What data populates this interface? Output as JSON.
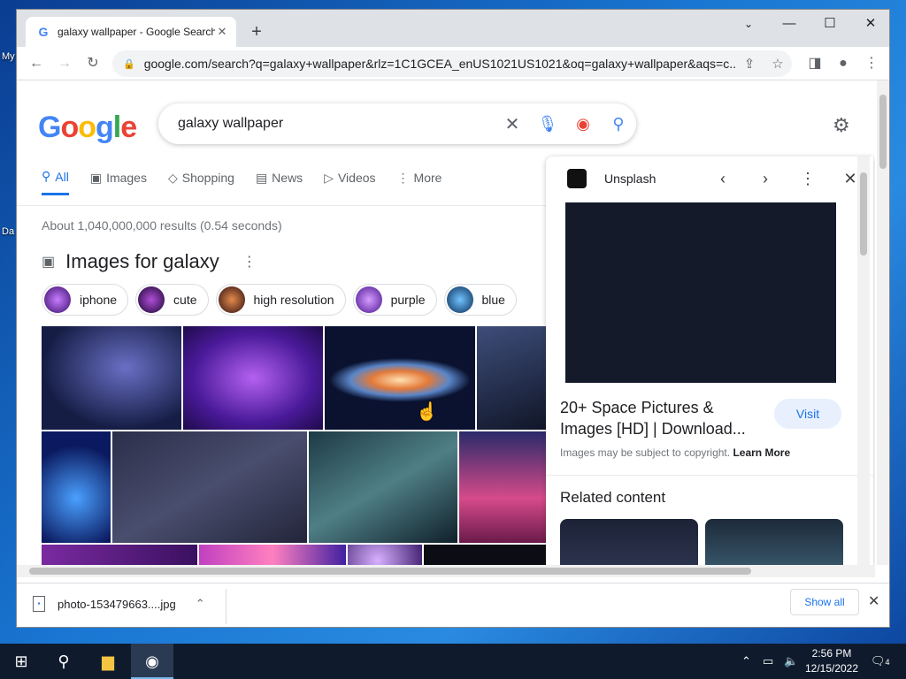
{
  "browser": {
    "tab_title": "galaxy wallpaper - Google Search",
    "new_tab_label": "+",
    "url": "google.com/search?q=galaxy+wallpaper&rlz=1C1GCEA_enUS1021US1021&oq=galaxy+wallpaper&aqs=c..."
  },
  "search": {
    "query": "galaxy wallpaper",
    "logo_text": "Google"
  },
  "nav_tabs": [
    {
      "label": "All"
    },
    {
      "label": "Images"
    },
    {
      "label": "Shopping"
    },
    {
      "label": "News"
    },
    {
      "label": "Videos"
    },
    {
      "label": "More"
    }
  ],
  "results_stats": "About 1,040,000,000 results (0.54 seconds)",
  "images_section": {
    "title": "Images for galaxy",
    "chips": [
      {
        "label": "iphone",
        "color": "#7a3fb0"
      },
      {
        "label": "cute",
        "color": "#5b1f8f"
      },
      {
        "label": "high resolution",
        "color": "#8a4a2a"
      },
      {
        "label": "purple",
        "color": "#8e44d0"
      },
      {
        "label": "blue",
        "color": "#1e6fb8"
      }
    ]
  },
  "side_panel": {
    "source": "Unsplash",
    "title": "20+ Space Pictures & Images [HD] | Download...",
    "visit_label": "Visit",
    "copyright_text": "Images may be subject to copyright.",
    "learn_more": "Learn More",
    "related_title": "Related content"
  },
  "downloads": {
    "filename": "photo-153479663....jpg",
    "show_all": "Show all"
  },
  "desktop": {
    "label_1": "My",
    "label_2": "Da"
  },
  "taskbar": {
    "time": "2:56 PM",
    "date": "12/15/2022",
    "notifications": "4"
  },
  "colors": {
    "accent": "#1a73e8",
    "desktop": "#1976d2",
    "taskbar": "#0f1b2d"
  }
}
